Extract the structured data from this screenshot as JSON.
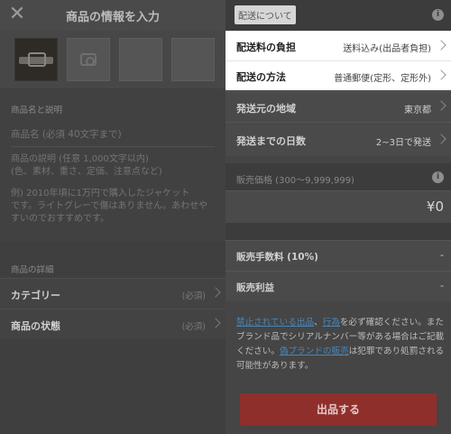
{
  "left": {
    "title": "商品の情報を入力",
    "close_icon": "close-icon",
    "section_name_desc": "商品名と説明",
    "name_placeholder": "商品名 (必須 40文字まで)",
    "desc_placeholder_line1": "商品の説明 (任意 1,000文字以内)",
    "desc_placeholder_line2": "(色、素材、重さ、定価、注意点など)",
    "example_line1": "例) 2010年頃に1万円で購入したジャケット",
    "example_line2": "です。ライトグレーで傷はありません。あわせや",
    "example_line3": "すいのでおすすめです。",
    "section_details": "商品の詳細",
    "rows": [
      {
        "label": "カテゴリー",
        "value": "(必須)"
      },
      {
        "label": "商品の状態",
        "value": "(必須)"
      }
    ]
  },
  "right": {
    "shipping_section_label": "配送について",
    "shipping_rows": [
      {
        "label": "配送料の負担",
        "value": "送料込み(出品者負担)"
      },
      {
        "label": "配送の方法",
        "value": "普通郵便(定形、定形外)"
      },
      {
        "label": "発送元の地域",
        "value": "東京都"
      },
      {
        "label": "発送までの日数",
        "value": "2~3日で発送"
      }
    ],
    "price_section_label": "販売価格 (300〜9,999,999)",
    "price_value": "¥0",
    "fee_label": "販売手数料 (10%)",
    "fee_value": "-",
    "profit_label": "販売利益",
    "profit_value": "-",
    "notice": {
      "link1": "禁止されている出品",
      "sep1": "、",
      "link2": "行為",
      "text1": "を必ず確認ください。またブランド品でシリアルナンバー等がある場合はご記載ください。",
      "link3": "偽ブランドの販売",
      "text2": "は犯罪であり処罰される可能性があります。"
    },
    "submit_label": "出品する",
    "colors": {
      "submit_bg": "#8f2f2c",
      "link": "#4a86b8"
    }
  }
}
